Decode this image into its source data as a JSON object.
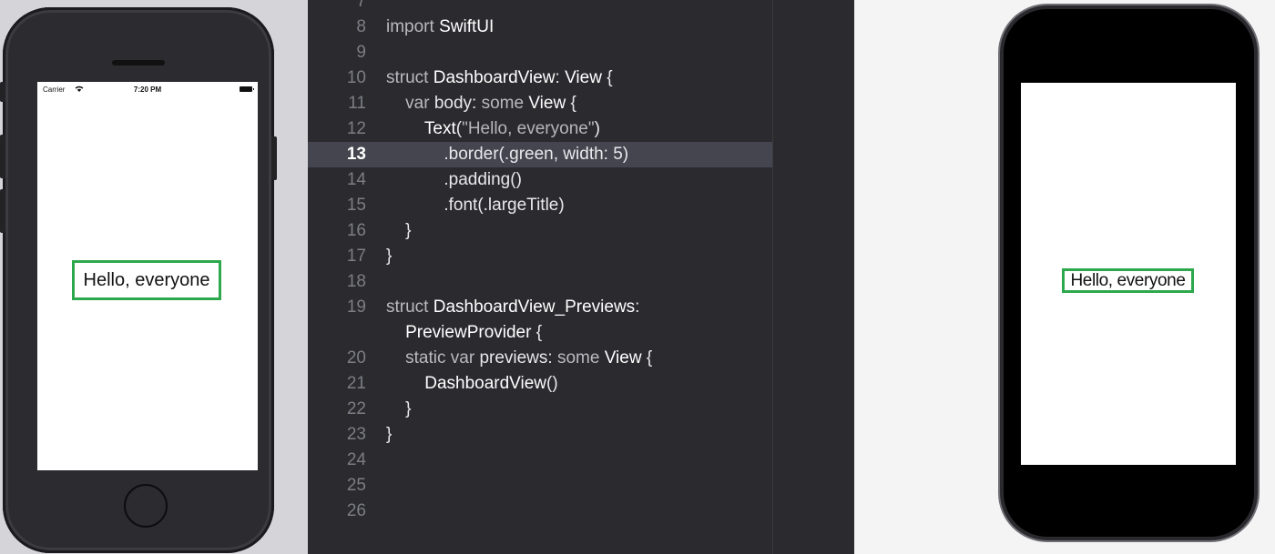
{
  "simulator": {
    "status": {
      "carrier": "Carrier",
      "time": "7:20 PM"
    },
    "hello_text": "Hello, everyone",
    "border_color": "#2ea84c"
  },
  "editor": {
    "active_line": "13",
    "lines": [
      {
        "num": "7",
        "tokens": []
      },
      {
        "num": "8",
        "tokens": [
          {
            "t": "kw",
            "v": "import "
          },
          {
            "t": "ty",
            "v": "SwiftUI"
          }
        ]
      },
      {
        "num": "9",
        "tokens": []
      },
      {
        "num": "10",
        "tokens": [
          {
            "t": "kw",
            "v": "struct "
          },
          {
            "t": "ty",
            "v": "DashboardView"
          },
          {
            "t": "pl",
            "v": ": "
          },
          {
            "t": "ty",
            "v": "View"
          },
          {
            "t": "pl",
            "v": " {"
          }
        ]
      },
      {
        "num": "11",
        "tokens": [
          {
            "t": "pl",
            "v": "    "
          },
          {
            "t": "kw",
            "v": "var "
          },
          {
            "t": "pl",
            "v": "body: "
          },
          {
            "t": "kw",
            "v": "some "
          },
          {
            "t": "ty",
            "v": "View"
          },
          {
            "t": "pl",
            "v": " {"
          }
        ]
      },
      {
        "num": "12",
        "tokens": [
          {
            "t": "pl",
            "v": "        "
          },
          {
            "t": "ty",
            "v": "Text"
          },
          {
            "t": "pl",
            "v": "("
          },
          {
            "t": "str",
            "v": "\"Hello, everyone\""
          },
          {
            "t": "pl",
            "v": ")"
          }
        ]
      },
      {
        "num": "13",
        "tokens": [
          {
            "t": "pl",
            "v": "            .border(.green, width: 5)"
          }
        ]
      },
      {
        "num": "14",
        "tokens": [
          {
            "t": "pl",
            "v": "            .padding()"
          }
        ]
      },
      {
        "num": "15",
        "tokens": [
          {
            "t": "pl",
            "v": "            .font(.largeTitle)"
          }
        ]
      },
      {
        "num": "16",
        "tokens": [
          {
            "t": "pl",
            "v": "    }"
          }
        ]
      },
      {
        "num": "17",
        "tokens": [
          {
            "t": "pl",
            "v": "}"
          }
        ]
      },
      {
        "num": "18",
        "tokens": []
      },
      {
        "num": "19",
        "tokens": [
          {
            "t": "kw",
            "v": "struct "
          },
          {
            "t": "ty",
            "v": "DashboardView_Previews"
          },
          {
            "t": "pl",
            "v": ":"
          }
        ]
      },
      {
        "num": "",
        "tokens": [
          {
            "t": "ty",
            "v": "    PreviewProvider"
          },
          {
            "t": "pl",
            "v": " {"
          }
        ]
      },
      {
        "num": "20",
        "tokens": [
          {
            "t": "pl",
            "v": "    "
          },
          {
            "t": "kw",
            "v": "static var "
          },
          {
            "t": "pl",
            "v": "previews: "
          },
          {
            "t": "kw",
            "v": "some "
          },
          {
            "t": "ty",
            "v": "View"
          },
          {
            "t": "pl",
            "v": " {"
          }
        ]
      },
      {
        "num": "21",
        "tokens": [
          {
            "t": "pl",
            "v": "        "
          },
          {
            "t": "ty",
            "v": "DashboardView"
          },
          {
            "t": "pl",
            "v": "()"
          }
        ]
      },
      {
        "num": "22",
        "tokens": [
          {
            "t": "pl",
            "v": "    }"
          }
        ]
      },
      {
        "num": "23",
        "tokens": [
          {
            "t": "pl",
            "v": "}"
          }
        ]
      },
      {
        "num": "24",
        "tokens": []
      },
      {
        "num": "25",
        "tokens": []
      },
      {
        "num": "26",
        "tokens": []
      }
    ]
  },
  "preview": {
    "hello_text": "Hello, everyone",
    "border_color": "#2ea84c"
  }
}
